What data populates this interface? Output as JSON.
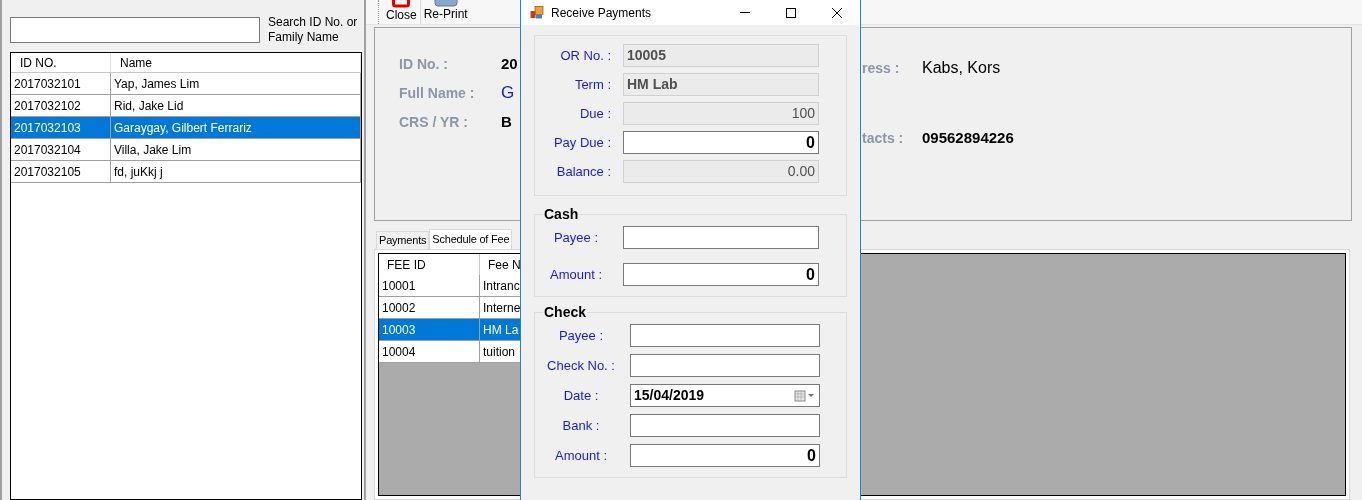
{
  "students": {
    "search_label": "Search ID No. or Family Name",
    "columns": [
      "ID NO.",
      "Name"
    ],
    "rows": [
      {
        "cells": [
          "2017032101",
          "Yap, James Lim"
        ],
        "selected": false
      },
      {
        "cells": [
          "2017032102",
          "Rid, Jake Lid"
        ],
        "selected": false
      },
      {
        "cells": [
          "2017032103",
          "Garaygay, Gilbert Ferrariz"
        ],
        "selected": true
      },
      {
        "cells": [
          "2017032104",
          "Villa, Jake Lim"
        ],
        "selected": false
      },
      {
        "cells": [
          "2017032105",
          "fd, juKkj j"
        ],
        "selected": false
      }
    ]
  },
  "toolbar": [
    {
      "label": "Close",
      "kind": "close"
    },
    {
      "label": "Re-Print",
      "kind": "print"
    }
  ],
  "student_info": {
    "left_fields": [
      {
        "label": "ID No. :",
        "value": "20",
        "kind": "bold"
      },
      {
        "label": "Full Name :",
        "value": "G",
        "kind": "link"
      },
      {
        "label": "CRS / YR  :",
        "value": "B",
        "kind": "bold"
      }
    ],
    "right_fields": [
      {
        "label": "ress :",
        "value": "Kabs, Kors",
        "kind": "plain"
      },
      {
        "label": "tacts :",
        "value": "09562894226",
        "kind": "bold"
      }
    ]
  },
  "tabs": [
    {
      "label": "Payments",
      "selected": false
    },
    {
      "label": "Schedule of Fee",
      "selected": true
    }
  ],
  "fees": {
    "columns": [
      "FEE ID",
      "Fee N"
    ],
    "rows": [
      {
        "cells": [
          "10001",
          "Intranc"
        ],
        "selected": false
      },
      {
        "cells": [
          "10002",
          "Interne"
        ],
        "selected": false
      },
      {
        "cells": [
          "10003",
          "HM La"
        ],
        "selected": true
      },
      {
        "cells": [
          "10004",
          "tuition"
        ],
        "selected": false
      }
    ]
  },
  "dialog": {
    "title": "Receive Payments",
    "summary": [
      {
        "label": "OR No. :",
        "value": "10005",
        "kind": "readonly_text"
      },
      {
        "label": "Term :",
        "value": "HM Lab",
        "kind": "readonly_text"
      },
      {
        "label": "Due :",
        "value": "100",
        "kind": "readonly_number"
      },
      {
        "label": "Pay Due :",
        "value": "0",
        "kind": "input_number"
      },
      {
        "label": "Balance :",
        "value": "0.00",
        "kind": "readonly_number"
      }
    ],
    "groups": [
      {
        "title": "Cash",
        "fields": [
          {
            "label": "Payee :",
            "kind": "input_text"
          },
          {
            "label": "Amount :",
            "value": "0",
            "kind": "input_number"
          }
        ]
      },
      {
        "title": "Check",
        "fields": [
          {
            "label": "Payee :",
            "kind": "input_text"
          },
          {
            "label": "Check No. :",
            "kind": "input_text"
          },
          {
            "label": "Date :",
            "value": "15/04/2019",
            "kind": "date"
          },
          {
            "label": "Bank :",
            "kind": "input_text"
          },
          {
            "label": "Amount :",
            "value": "0",
            "kind": "input_number"
          }
        ]
      }
    ]
  }
}
